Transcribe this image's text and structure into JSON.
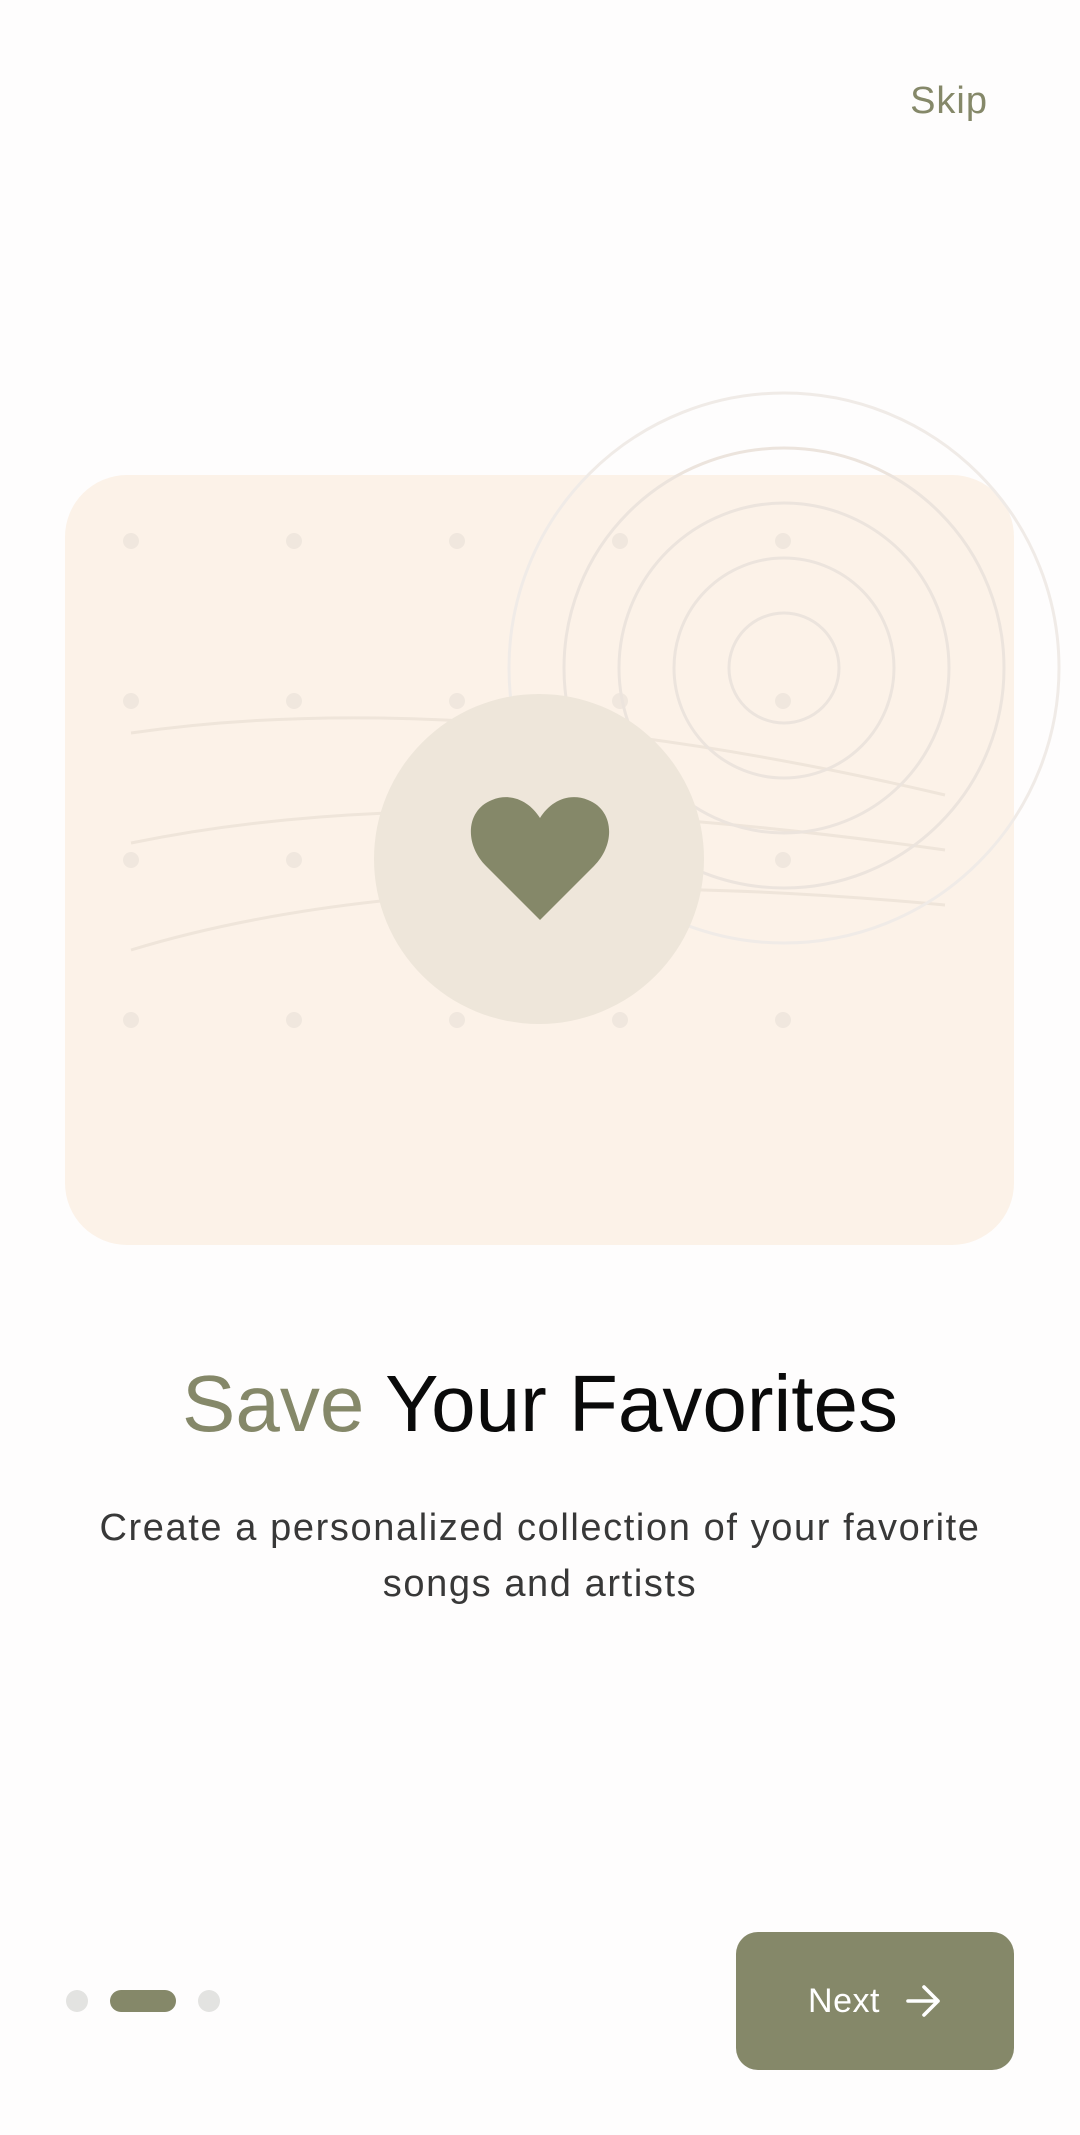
{
  "header": {
    "skip_label": "Skip"
  },
  "illustration": {
    "icon": "heart-icon",
    "colors": {
      "card_background": "#fcf2e8",
      "icon_circle": "#eee6da",
      "accent": "#858869"
    }
  },
  "content": {
    "title_accent": "Save",
    "title_rest": " Your Favorites",
    "subtitle": "Create a personalized collection of your favorite songs and artists"
  },
  "pagination": {
    "total": 3,
    "active_index": 1
  },
  "footer": {
    "next_label": "Next",
    "next_icon": "arrow-right-icon"
  }
}
